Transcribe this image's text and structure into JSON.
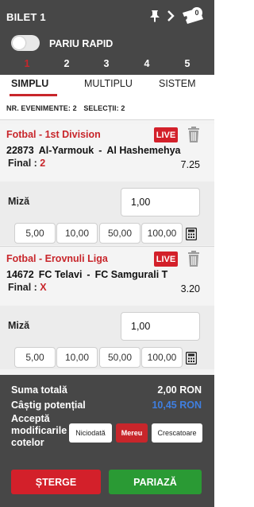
{
  "header": {
    "title": "BILET 1",
    "badge_count": "0",
    "rapid_label": "PARIU RAPID",
    "rapid_on": false,
    "ticket_numbers": [
      "1",
      "2",
      "3",
      "4",
      "5"
    ],
    "active_ticket": "1"
  },
  "tabs": [
    "SIMPLU",
    "MULTIPLU",
    "SISTEM"
  ],
  "active_tab": "SIMPLU",
  "summary": {
    "events": "NR. EVENIMENTE: 2",
    "selections": "SELECȚII: 2"
  },
  "bets": [
    {
      "league": "Fotbal - 1st Division",
      "live": "LIVE",
      "code": "22873",
      "home": "Al-Yarmouk",
      "separator": "-",
      "away": "Al Hashemehya",
      "market": "Final :",
      "pick": "2",
      "odds": "7.25",
      "stake_label": "Miză",
      "stake": "1,00",
      "quick_amounts": [
        "5,00",
        "10,00",
        "50,00",
        "100,00"
      ]
    },
    {
      "league": "Fotbal - Erovnuli Liga",
      "live": "LIVE",
      "code": "14672",
      "home": "FC Telavi",
      "separator": "-",
      "away": "FC Samgurali T",
      "market": "Final :",
      "pick": "X",
      "odds": "3.20",
      "stake_label": "Miză",
      "stake": "1,00",
      "quick_amounts": [
        "5,00",
        "10,00",
        "50,00",
        "100,00"
      ]
    }
  ],
  "footer": {
    "total_label": "Suma totală",
    "total_value": "2,00 RON",
    "win_label": "Câștig potențial",
    "win_value": "10,45 RON",
    "accept_lines": [
      "Acceptă",
      "modificarile",
      "cotelor"
    ],
    "accept_options": [
      "Niciodată",
      "Mereu",
      "Crescatoare"
    ],
    "accept_selected": "Mereu",
    "delete_label": "ȘTERGE",
    "place_label": "PARIAZĂ"
  },
  "colors": {
    "header_bg": "#474747",
    "accent_red": "#c8262b",
    "live_red": "#d3202a",
    "potential_blue": "#3f7fe0",
    "place_green": "#2a9a34"
  },
  "icons": [
    "pin-icon",
    "chevron-right-icon",
    "ticket-icon",
    "trash-icon",
    "calculator-icon"
  ]
}
